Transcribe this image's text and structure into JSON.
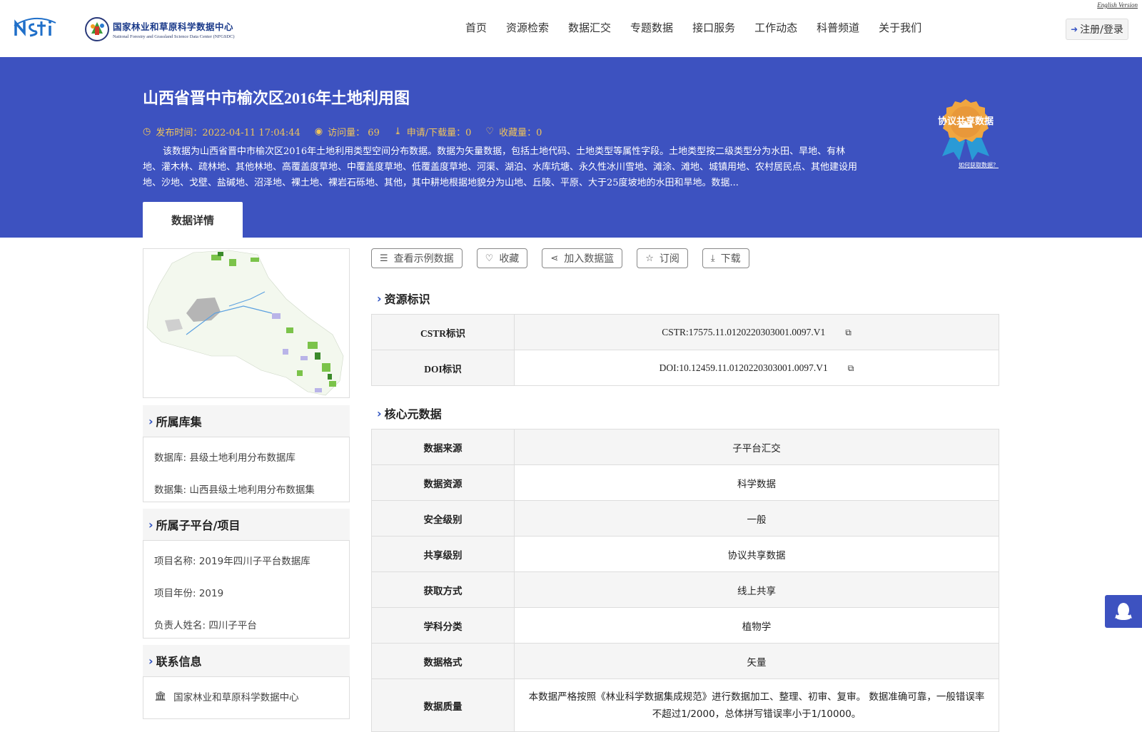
{
  "header": {
    "english_version": "English Version",
    "center_name_cn": "国家林业和草原科学数据中心",
    "center_name_en": "National Forestry and Grassland Science Data Center (NFGSDC)",
    "nav": [
      "首页",
      "资源检索",
      "数据汇交",
      "专题数据",
      "接口服务",
      "工作动态",
      "科普频道",
      "关于我们"
    ],
    "login": "注册/登录"
  },
  "banner": {
    "title": "山西省晋中市榆次区2016年土地利用图",
    "publish_time": "发布时间：2022-04-11 17:04:44",
    "views": "访问量： 69",
    "downloads": "申请/下载量：0",
    "favorites": "收藏量：0",
    "description": "该数据为山西省晋中市榆次区2016年土地利用类型空间分布数据。数据为矢量数据，包括土地代码、土地类型等属性字段。土地类型按二级类型分为水田、旱地、有林地、灌木林、疏林地、其他林地、高覆盖度草地、中覆盖度草地、低覆盖度草地、河渠、湖泊、水库坑塘、永久性冰川雪地、滩涂、滩地、城镇用地、农村居民点、其他建设用地、沙地、戈壁、盐碱地、沼泽地、裸土地、裸岩石砾地、其他，其中耕地根据地貌分为山地、丘陵、平原、大于25度坡地的水田和旱地。数据...",
    "share_badge": "协议共享数据",
    "how_link": "如何获取数据？",
    "tab": "数据详情"
  },
  "sidebar": {
    "library_title": "所属库集",
    "library_rows": [
      "数据库: 县级土地利用分布数据库",
      "数据集: 山西县级土地利用分布数据集"
    ],
    "project_title": "所属子平台/项目",
    "project_rows": [
      "项目名称: 2019年四川子平台数据库",
      "项目年份: 2019",
      "负责人姓名: 四川子平台"
    ],
    "contact_title": "联系信息",
    "contact_org": "国家林业和草原科学数据中心"
  },
  "actions": [
    "查看示例数据",
    "收藏",
    "加入数据篮",
    "订阅",
    "下载"
  ],
  "resource_id": {
    "title": "资源标识",
    "rows": [
      {
        "key": "CSTR标识",
        "value": "CSTR:17575.11.0120220303001.0097.V1"
      },
      {
        "key": "DOI标识",
        "value": "DOI:10.12459.11.0120220303001.0097.V1"
      }
    ]
  },
  "core_meta": {
    "title": "核心元数据",
    "rows": [
      {
        "key": "数据来源",
        "value": "子平台汇交"
      },
      {
        "key": "数据资源",
        "value": "科学数据"
      },
      {
        "key": "安全级别",
        "value": "一般"
      },
      {
        "key": "共享级别",
        "value": "协议共享数据"
      },
      {
        "key": "获取方式",
        "value": "线上共享"
      },
      {
        "key": "学科分类",
        "value": "植物学"
      },
      {
        "key": "数据格式",
        "value": "矢量"
      },
      {
        "key": "数据质量",
        "value": "本数据严格按照《林业科学数据集成规范》进行数据加工、整理、初审、复审。 数据准确可靠，一般错误率不超过1/2000，总体拼写错误率小于1/10000。"
      }
    ]
  },
  "colors": {
    "brand_blue": "#3d52c0",
    "meta_gold": "#f0c45a"
  }
}
